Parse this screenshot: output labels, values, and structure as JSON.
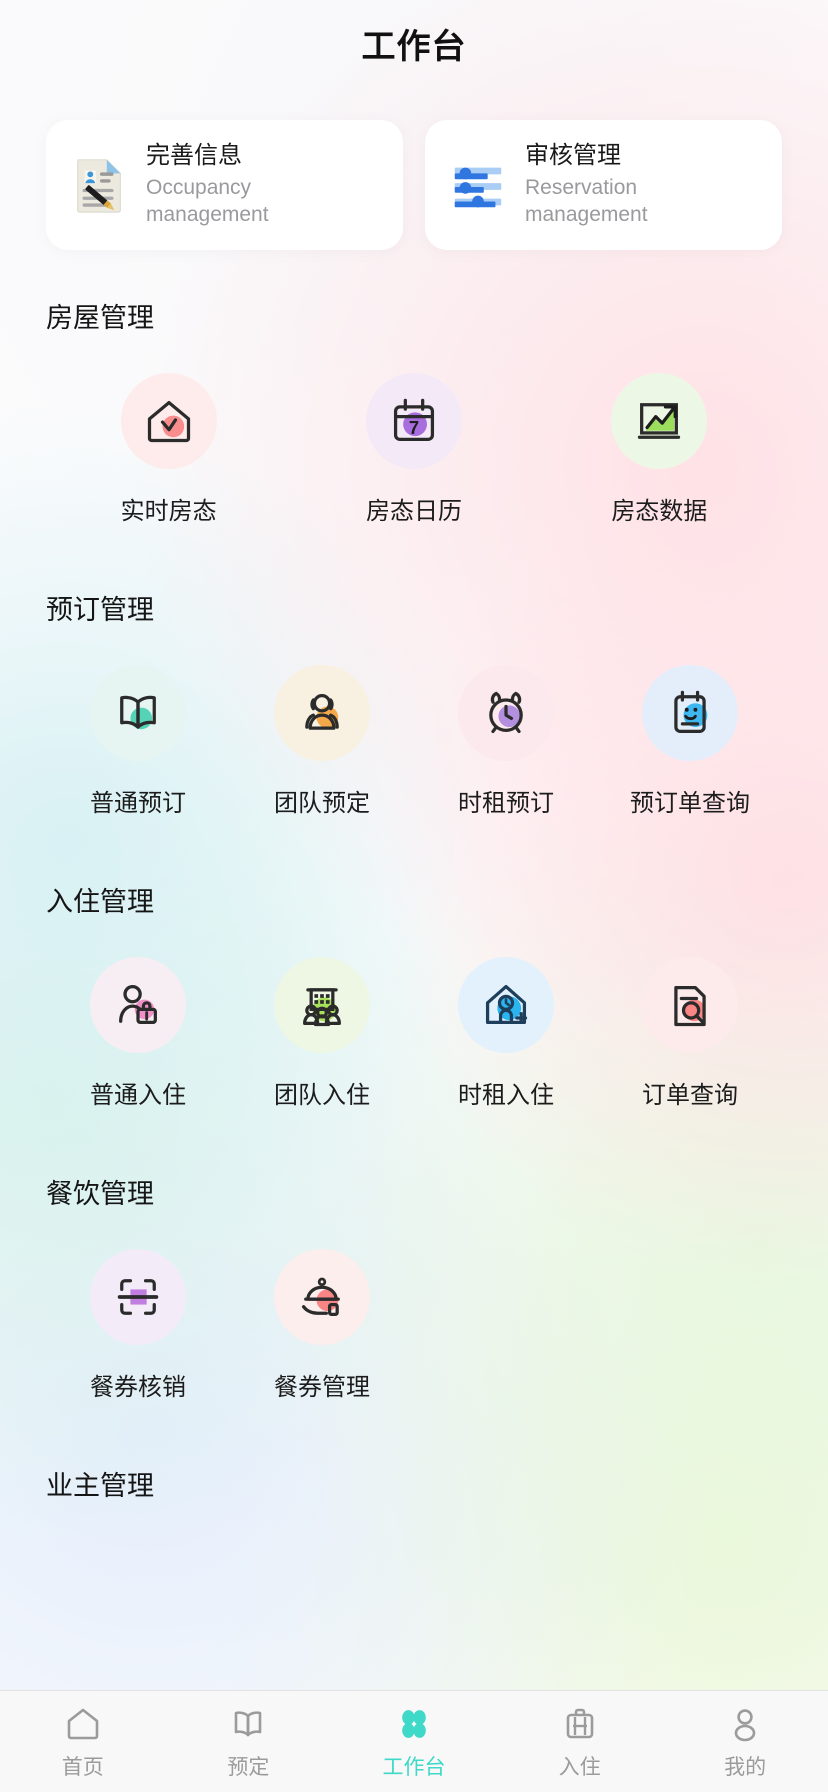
{
  "header": {
    "title": "工作台"
  },
  "theme": {
    "accent": "#3fd9c9",
    "tab_inactive": "#9b9b9b",
    "card_bg": "#ffffff",
    "title_color": "#111111",
    "subtitle_color": "#9a9a9e"
  },
  "quick_cards": [
    {
      "title": "完善信息",
      "subtitle": "Occupancy management",
      "icon": "document-pen-icon"
    },
    {
      "title": "审核管理",
      "subtitle": "Reservation management",
      "icon": "sliders-icon"
    }
  ],
  "sections": [
    {
      "title": "房屋管理",
      "columns": 3,
      "items": [
        {
          "label": "实时房态",
          "icon": "house-check-icon",
          "bubble": "#fdeceb"
        },
        {
          "label": "房态日历",
          "icon": "calendar-7-icon",
          "bubble": "#f4eaf7"
        },
        {
          "label": "房态数据",
          "icon": "chart-trend-icon",
          "bubble": "#edf7e6"
        }
      ]
    },
    {
      "title": "预订管理",
      "columns": 4,
      "items": [
        {
          "label": "普通预订",
          "icon": "open-book-icon",
          "bubble": "#e6f5f2"
        },
        {
          "label": "团队预定",
          "icon": "group-people-icon",
          "bubble": "#f8f1e2"
        },
        {
          "label": "时租预订",
          "icon": "alarm-clock-icon",
          "bubble": "#fbe9ed"
        },
        {
          "label": "预订单查询",
          "icon": "clipboard-book-icon",
          "bubble": "#e3eefa"
        }
      ]
    },
    {
      "title": "入住管理",
      "columns": 4,
      "items": [
        {
          "label": "普通入住",
          "icon": "person-luggage-icon",
          "bubble": "#f6eef2"
        },
        {
          "label": "团队入住",
          "icon": "building-group-icon",
          "bubble": "#eef7e4"
        },
        {
          "label": "时租入住",
          "icon": "house-clock-plus-icon",
          "bubble": "#e2f1fb"
        },
        {
          "label": "订单查询",
          "icon": "document-search-icon",
          "bubble": "#fdeaea"
        }
      ]
    },
    {
      "title": "餐饮管理",
      "columns": 4,
      "items": [
        {
          "label": "餐券核销",
          "icon": "scan-code-icon",
          "bubble": "#f3ecf8"
        },
        {
          "label": "餐券管理",
          "icon": "food-tray-icon",
          "bubble": "#fbeeec"
        }
      ]
    },
    {
      "title": "业主管理",
      "columns": 4,
      "items": []
    }
  ],
  "tabbar": {
    "active_index": 2,
    "items": [
      {
        "label": "首页",
        "icon": "home-icon"
      },
      {
        "label": "预定",
        "icon": "book-icon"
      },
      {
        "label": "工作台",
        "icon": "clover-icon"
      },
      {
        "label": "入住",
        "icon": "suitcase-icon"
      },
      {
        "label": "我的",
        "icon": "person-icon"
      }
    ]
  }
}
